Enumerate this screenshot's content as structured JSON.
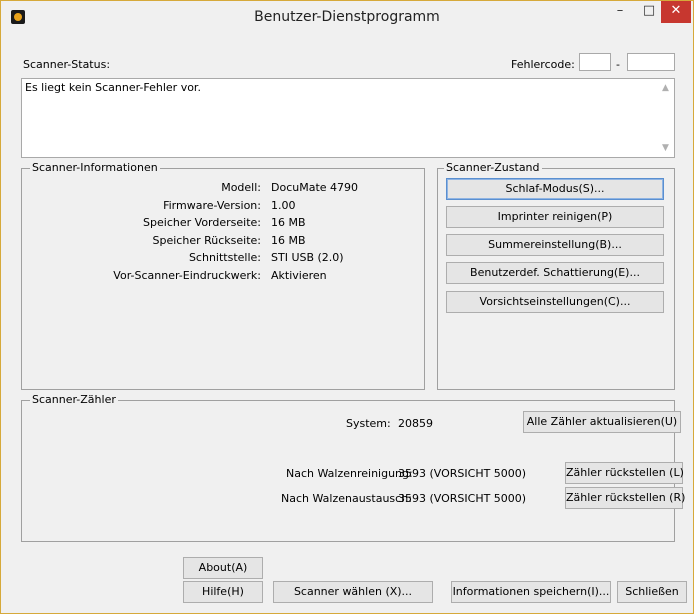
{
  "window": {
    "title": "Benutzer-Dienstprogramm",
    "minimize": "–",
    "maximize": "□",
    "close": "✕"
  },
  "status": {
    "label": "Scanner-Status:",
    "error_code_label": "Fehlercode:",
    "error_code_sep": "-",
    "message": "Es liegt kein Scanner-Fehler vor."
  },
  "info": {
    "title": "Scanner-Informationen",
    "rows": [
      {
        "key": "Modell:",
        "value": "DocuMate 4790"
      },
      {
        "key": "Firmware-Version:",
        "value": "1.00"
      },
      {
        "key": "Speicher Vorderseite:",
        "value": "16 MB"
      },
      {
        "key": "Speicher Rückseite:",
        "value": "16 MB"
      },
      {
        "key": "Schnittstelle:",
        "value": "STI USB (2.0)"
      },
      {
        "key": "Vor-Scanner-Eindruckwerk:",
        "value": "Aktivieren"
      }
    ]
  },
  "state": {
    "title": "Scanner-Zustand",
    "buttons": [
      "Schlaf-Modus(S)...",
      "Imprinter reinigen(P)",
      "Summereinstellung(B)...",
      "Benutzerdef. Schattierung(E)...",
      "Vorsichtseinstellungen(C)..."
    ]
  },
  "counter": {
    "title": "Scanner-Zähler",
    "system_label": "System:",
    "system_value": "20859",
    "update_all": "Alle Zähler aktualisieren(U)",
    "roller_clean_label": "Nach Walzenreinigung:",
    "roller_clean_value": "3593 (VORSICHT 5000)",
    "reset_l": "Zähler rückstellen (L)",
    "roller_replace_label": "Nach Walzenaustausch:",
    "roller_replace_value": "3593 (VORSICHT 5000)",
    "reset_r": "Zähler rückstellen (R)"
  },
  "footer": {
    "about": "About(A)",
    "help": "Hilfe(H)",
    "choose_scanner": "Scanner wählen (X)...",
    "save_info": "Informationen speichern(I)...",
    "close": "Schließen"
  }
}
